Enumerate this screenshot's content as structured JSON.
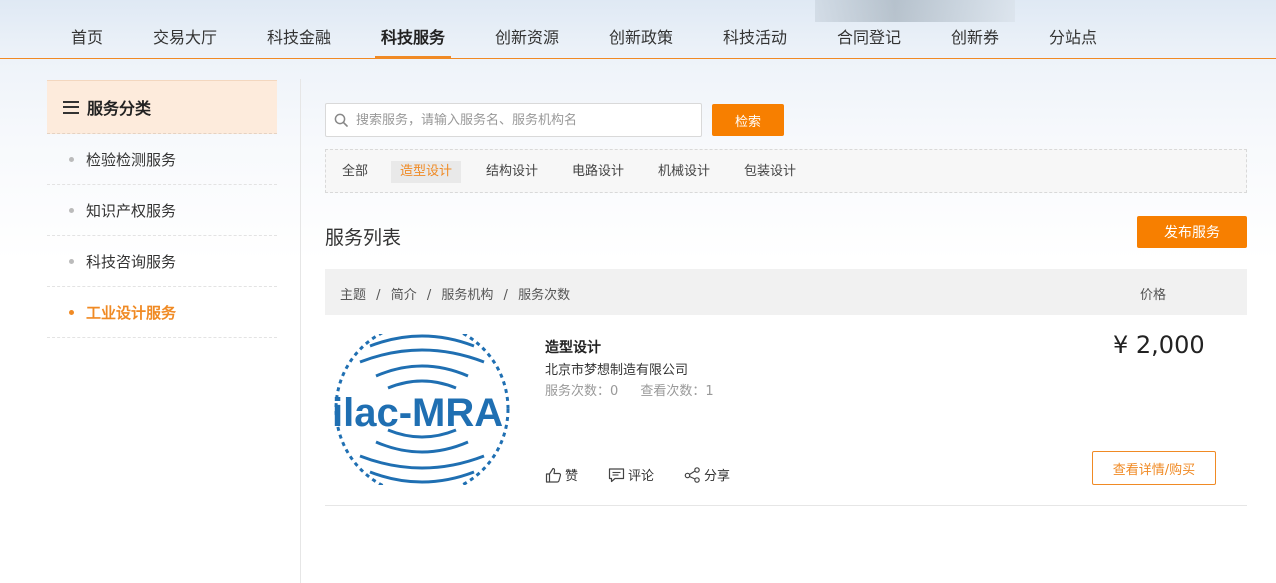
{
  "nav": {
    "items": [
      "首页",
      "交易大厅",
      "科技金融",
      "科技服务",
      "创新资源",
      "创新政策",
      "科技活动",
      "合同登记",
      "创新券",
      "分站点"
    ],
    "active": "科技服务"
  },
  "sidebar": {
    "header": "服务分类",
    "items": [
      {
        "label": "检验检测服务"
      },
      {
        "label": "知识产权服务"
      },
      {
        "label": "科技咨询服务"
      },
      {
        "label": "工业设计服务"
      }
    ],
    "active": "工业设计服务"
  },
  "search": {
    "placeholder": "搜索服务，请输入服务名、服务机构名",
    "value": "",
    "button_label": "检索"
  },
  "filters": {
    "items": [
      "全部",
      "造型设计",
      "结构设计",
      "电路设计",
      "机械设计",
      "包装设计"
    ],
    "active": "造型设计"
  },
  "list": {
    "title": "服务列表",
    "publish_label": "发布服务",
    "header": {
      "columns_left": [
        "主题",
        "简介",
        "服务机构",
        "服务次数"
      ],
      "separator": "/",
      "price_label": "价格"
    },
    "items": [
      {
        "logo_text": "ilac-MRA",
        "title": "造型设计",
        "org": "北京市梦想制造有限公司",
        "service_count_label": "服务次数：0",
        "view_count_label": "查看次数：1",
        "price": "¥ 2,000",
        "like_label": "赞",
        "comment_label": "评论",
        "share_label": "分享",
        "detail_label": "查看详情/购买"
      }
    ]
  },
  "colors": {
    "accent": "#f08a24",
    "button": "#f77f00",
    "logo_blue": "#1f6fb2"
  },
  "icons": {
    "search": "search-icon",
    "menu": "menu-icon",
    "like": "thumbs-up-icon",
    "comment": "comment-icon",
    "share": "share-icon"
  }
}
